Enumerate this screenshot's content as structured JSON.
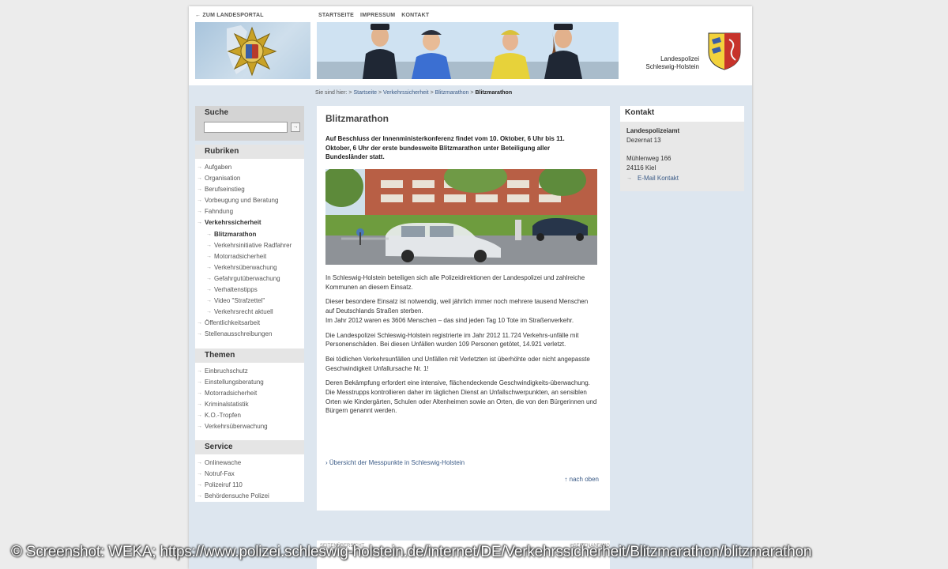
{
  "topbar": {
    "back_link": "← ZUM LANDESPORTAL",
    "nav": [
      "STARTSEITE",
      "IMPRESSUM",
      "KONTAKT"
    ]
  },
  "brand": {
    "line1": "Landespolizei",
    "line2": "Schleswig-Holstein"
  },
  "breadcrumb": {
    "prefix": "Sie sind hier:",
    "items": [
      "Startseite",
      "Verkehrssicherheit",
      "Blitzmarathon"
    ],
    "current": "Blitzmarathon"
  },
  "sidebar": {
    "search": {
      "title": "Suche",
      "placeholder": "",
      "button": "→"
    },
    "rubriken": {
      "title": "Rubriken",
      "items": [
        {
          "label": "Aufgaben"
        },
        {
          "label": "Organisation"
        },
        {
          "label": "Berufseinstieg"
        },
        {
          "label": "Vorbeugung und Beratung"
        },
        {
          "label": "Fahndung"
        },
        {
          "label": "Verkehrssicherheit"
        },
        {
          "label": "Blitzmarathon"
        },
        {
          "label": "Verkehrsinitiative Radfahrer"
        },
        {
          "label": "Motorradsicherheit"
        },
        {
          "label": "Verkehrsüberwachung"
        },
        {
          "label": "Gefahrgutüberwachung"
        },
        {
          "label": "Verhaltenstipps"
        },
        {
          "label": "Video \"Strafzettel\""
        },
        {
          "label": "Verkehrsrecht aktuell"
        },
        {
          "label": "Öffentlichkeitsarbeit"
        },
        {
          "label": "Stellenausschreibungen"
        }
      ]
    },
    "themen": {
      "title": "Themen",
      "items": [
        "Einbruchschutz",
        "Einstellungsberatung",
        "Motorradsicherheit",
        "Kriminalstatistik",
        "K.O.-Tropfen",
        "Verkehrsüberwachung"
      ]
    },
    "service": {
      "title": "Service",
      "items": [
        "Onlinewache",
        "Notruf-Fax",
        "Polizeiruf 110",
        "Behördensuche Polizei"
      ]
    }
  },
  "main": {
    "title": "Blitzmarathon",
    "lead": "Auf Beschluss der Innenministerkonferenz findet vom 10. Oktober, 6 Uhr bis 11. Oktober, 6 Uhr der erste bundesweite Blitzmarathon unter Beteiligung aller Bundesländer statt.",
    "paragraphs": [
      "In Schleswig-Holstein beteiligen sich alle Polizeidirektionen der Landespolizei und zahlreiche Kommunen an diesem Einsatz.",
      "Dieser besondere Einsatz ist notwendig, weil jährlich immer noch mehrere tausend Menschen auf Deutschlands Straßen sterben.\nIm Jahr 2012 waren es 3606 Menschen – das sind jeden Tag 10 Tote im Straßenverkehr.",
      "Die Landespolizei Schleswig-Holstein registrierte im Jahr 2012 11.724 Verkehrs-unfälle mit Personenschäden. Bei diesen Unfällen wurden 109 Personen getötet, 14.921 verletzt.",
      "Bei tödlichen Verkehrsunfällen und Unfällen mit Verletzten ist überhöhte oder nicht angepasste Geschwindigkeit Unfallursache Nr. 1!",
      "Deren Bekämpfung erfordert eine intensive, flächendeckende Geschwindigkeits-überwachung. Die Messtrupps kontrollieren daher im täglichen Dienst an Unfallschwerpunkten, an sensiblen Orten wie Kindergärten, Schulen oder Altenheimen sowie an Orten, die von den Bürgerinnen und Bürgern genannt werden."
    ],
    "overview_link": "› Übersicht der Messpunkte in Schleswig-Holstein",
    "top_link": "↑ nach oben"
  },
  "contact": {
    "title": "Kontakt",
    "org": "Landespolizeiamt",
    "dept": "Dezernat 13",
    "street": "Mühlenweg 166",
    "city": "24116 Kiel",
    "mail": "E-Mail Kontakt"
  },
  "footer": {
    "left": "SEITENÜBERSICHT",
    "right": "SEITENANFANG"
  },
  "watermark": "© Screenshot: WEKA; https://www.polizei.schleswig-holstein.de/internet/DE/Verkehrssicherheit/Blitzmarathon/blitzmarathon",
  "colors": {
    "link": "#3a5a86",
    "page_bg": "#dde6ef",
    "panel_bg": "#ffffff",
    "section_head_bg": "#e5e5e5"
  }
}
